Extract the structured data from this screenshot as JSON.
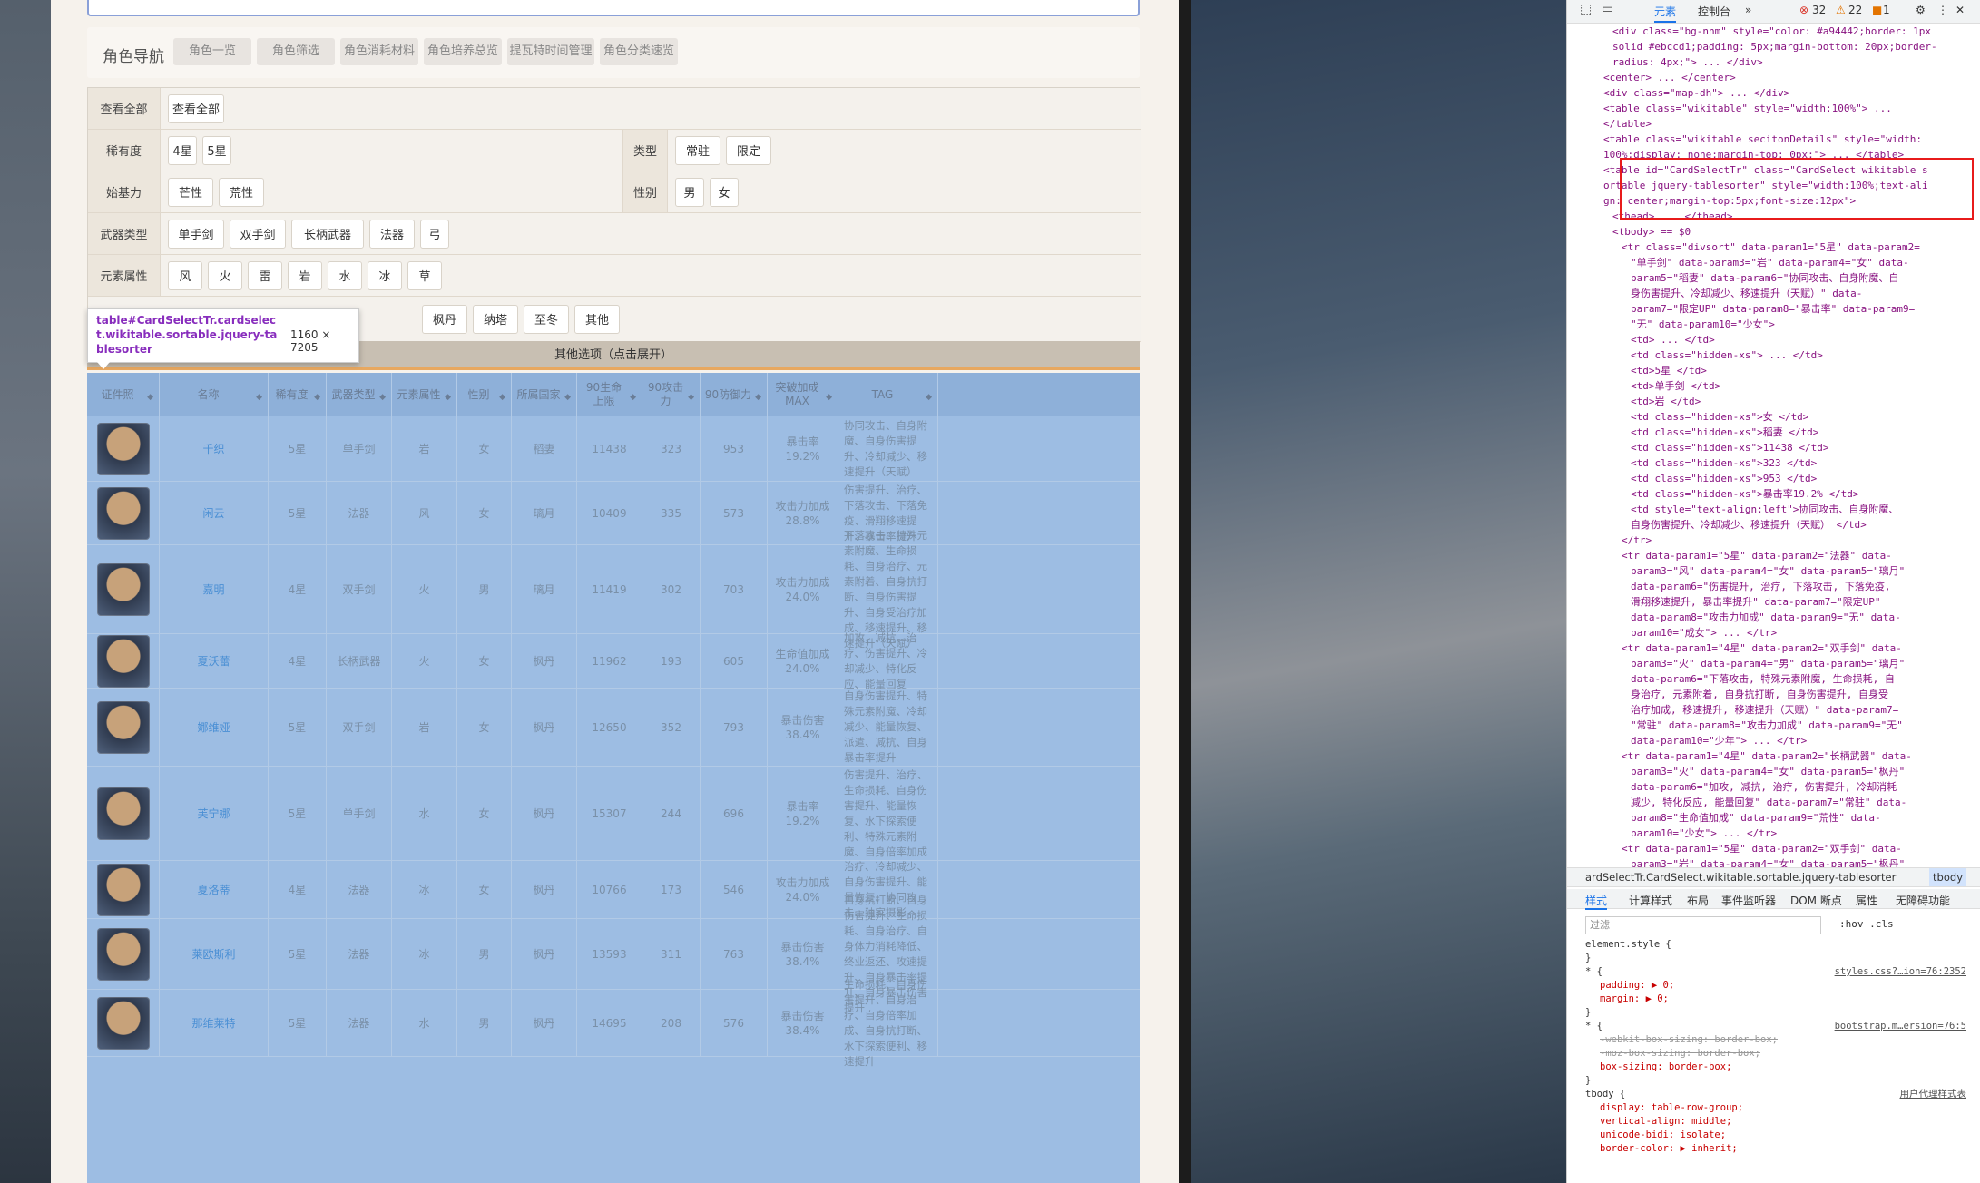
{
  "nav": {
    "title": "角色导航",
    "items": [
      "角色一览",
      "角色筛选",
      "角色消耗材料",
      "角色培养总览",
      "提瓦特时间管理",
      "角色分类速览"
    ]
  },
  "filters": {
    "view_all": {
      "label": "查看全部",
      "btn": "查看全部"
    },
    "rarity": {
      "label": "稀有度",
      "options": [
        "4星",
        "5星"
      ]
    },
    "type": {
      "label": "类型",
      "options": [
        "常驻",
        "限定"
      ]
    },
    "breakthrough": {
      "label": "始基力",
      "options": [
        "芒性",
        "荒性"
      ]
    },
    "gender": {
      "label": "性别",
      "options": [
        "男",
        "女"
      ]
    },
    "weapon": {
      "label": "武器类型",
      "options": [
        "单手剑",
        "双手剑",
        "长柄武器",
        "法器",
        "弓"
      ]
    },
    "element": {
      "label": "元素属性",
      "options": [
        "风",
        "火",
        "雷",
        "岩",
        "水",
        "冰",
        "草"
      ]
    },
    "region": {
      "options": [
        "枫丹",
        "纳塔",
        "至冬",
        "其他"
      ]
    }
  },
  "tooltip": {
    "selector": "table#CardSelectTr.cardselect.wikitable.sortable.jquery-tablesorter",
    "size": "1160 × 7205"
  },
  "other_options": "其他选项（点击展开）",
  "table": {
    "headers": [
      "证件照",
      "名称",
      "稀有度",
      "武器类型",
      "元素属性",
      "性别",
      "所属国家",
      "90生命上限",
      "90攻击力",
      "90防御力",
      "突破加成MAX",
      "TAG"
    ],
    "rows": [
      [
        "千织",
        "5星",
        "单手剑",
        "岩",
        "女",
        "稻妻",
        "11438",
        "323",
        "953",
        "暴击率19.2%",
        "协同攻击、自身附魔、自身伤害提升、冷却减少、移速提升（天赋）"
      ],
      [
        "闲云",
        "5星",
        "法器",
        "风",
        "女",
        "璃月",
        "10409",
        "335",
        "573",
        "攻击力加成28.8%",
        "伤害提升、治疗、下落攻击、下落免疫、滑翔移速提升、暴击率提升"
      ],
      [
        "嘉明",
        "4星",
        "双手剑",
        "火",
        "男",
        "璃月",
        "11419",
        "302",
        "703",
        "攻击力加成24.0%",
        "下落攻击、特殊元素附魔、生命损耗、自身治疗、元素附着、自身抗打断、自身伤害提升、自身受治疗加成、移速提升、移速提升（天赋）"
      ],
      [
        "夏沃蕾",
        "4星",
        "长柄武器",
        "火",
        "女",
        "枫丹",
        "11962",
        "193",
        "605",
        "生命值加成24.0%",
        "加攻、减抗、治疗、伤害提升、冷却减少、特化反应、能量回复"
      ],
      [
        "娜维娅",
        "5星",
        "双手剑",
        "岩",
        "女",
        "枫丹",
        "12650",
        "352",
        "793",
        "暴击伤害38.4%",
        "自身伤害提升、特殊元素附魔、冷却减少、能量恢复、派遣、减抗、自身暴击率提升"
      ],
      [
        "芙宁娜",
        "5星",
        "单手剑",
        "水",
        "女",
        "枫丹",
        "15307",
        "244",
        "696",
        "暴击率19.2%",
        "伤害提升、治疗、生命损耗、自身伤害提升、能量恢复、水下探索便利、特殊元素附魔、自身倍率加成"
      ],
      [
        "夏洛蒂",
        "4星",
        "法器",
        "冰",
        "女",
        "枫丹",
        "10766",
        "173",
        "546",
        "攻击力加成24.0%",
        "治疗、冷却减少、自身伤害提升、能量恢复、协同攻击、独家摄影"
      ],
      [
        "莱欧斯利",
        "5星",
        "法器",
        "冰",
        "男",
        "枫丹",
        "13593",
        "311",
        "763",
        "暴击伤害38.4%",
        "自身抗打断、自身伤害提升、生命损耗、自身治疗、自身体力消耗降低、终业返还、攻速提升、自身暴击率提升、自身暴击伤害提升"
      ],
      [
        "那维莱特",
        "5星",
        "法器",
        "水",
        "男",
        "枫丹",
        "14695",
        "208",
        "576",
        "暴击伤害38.4%",
        "生命损耗、自身伤害提升、自身治疗、自身倍率加成、自身抗打断、水下探索便利、移速提升"
      ]
    ]
  },
  "devtools": {
    "tabs": [
      "元素",
      "控制台"
    ],
    "errors": "32",
    "warnings": "22",
    "info": "1",
    "dom_lines": [
      "<div class=\"bg-nnm\" style=\"color: #a94442;border: 1px",
      "solid #ebccd1;padding: 5px;margin-bottom: 20px;border-",
      "radius: 4px;\"> ... </div>",
      "<center> ... </center>",
      "<div class=\"map-dh\"> ... </div>",
      "<table class=\"wikitable\" style=\"width:100%\"> ...",
      "</table>",
      "<table class=\"wikitable secitonDetails\" style=\"width:",
      "100%;display: none;margin-top: 0px;\"> ... </table>",
      "<table id=\"CardSelectTr\" class=\"CardSelect wikitable s",
      "ortable jquery-tablesorter\" style=\"width:100%;text-ali",
      "gn: center;margin-top:5px;font-size:12px\">",
      "<thead> ... </thead>",
      "<tbody> == $0",
      "<tr class=\"divsort\" data-param1=\"5星\" data-param2=",
      "\"单手剑\" data-param3=\"岩\" data-param4=\"女\" data-",
      "param5=\"稻妻\" data-param6=\"协同攻击、自身附魔、自",
      "身伤害提升、冷却减少、移速提升（天赋）\" data-",
      "param7=\"限定UP\" data-param8=\"暴击率\" data-param9=",
      "\"无\" data-param10=\"少女\">",
      "<td> ... </td>",
      "<td class=\"hidden-xs\"> ... </td>",
      "<td>5星 </td>",
      "<td>单手剑 </td>",
      "<td>岩 </td>",
      "<td class=\"hidden-xs\">女 </td>",
      "<td class=\"hidden-xs\">稻妻 </td>",
      "<td class=\"hidden-xs\">11438 </td>",
      "<td class=\"hidden-xs\">323 </td>",
      "<td class=\"hidden-xs\">953 </td>",
      "<td class=\"hidden-xs\">暴击率19.2% </td>",
      "<td style=\"text-align:left\">协同攻击、自身附魔、",
      "自身伤害提升、冷却减少、移速提升（天赋） </td>",
      "</tr>",
      "<tr data-param1=\"5星\" data-param2=\"法器\" data-",
      "param3=\"风\" data-param4=\"女\" data-param5=\"璃月\"",
      "data-param6=\"伤害提升, 治疗, 下落攻击, 下落免疫,",
      "滑翔移速提升, 暴击率提升\" data-param7=\"限定UP\"",
      "data-param8=\"攻击力加成\" data-param9=\"无\" data-",
      "param10=\"成女\"> ... </tr>",
      "<tr data-param1=\"4星\" data-param2=\"双手剑\" data-",
      "param3=\"火\" data-param4=\"男\" data-param5=\"璃月\"",
      "data-param6=\"下落攻击, 特殊元素附魔, 生命损耗, 自",
      "身治疗, 元素附着, 自身抗打断, 自身伤害提升, 自身受",
      "治疗加成, 移速提升, 移速提升（天赋）\" data-param7=",
      "\"常驻\" data-param8=\"攻击力加成\" data-param9=\"无\"",
      "data-param10=\"少年\"> ... </tr>",
      "<tr data-param1=\"4星\" data-param2=\"长柄武器\" data-",
      "param3=\"火\" data-param4=\"女\" data-param5=\"枫丹\"",
      "data-param6=\"加攻, 减抗, 治疗, 伤害提升, 冷却消耗",
      "减少, 特化反应, 能量回复\" data-param7=\"常驻\" data-",
      "param8=\"生命值加成\" data-param9=\"荒性\" data-",
      "param10=\"少女\"> ... </tr>",
      "<tr data-param1=\"5星\" data-param2=\"双手剑\" data-",
      "param3=\"岩\" data-param4=\"女\" data-param5=\"枫丹\""
    ],
    "breadcrumb": "ardSelectTr.CardSelect.wikitable.sortable.jquery-tablesorter",
    "breadcrumb_tail": "tbody",
    "style_tabs": [
      "样式",
      "计算样式",
      "布局",
      "事件监听器",
      "DOM 断点",
      "属性",
      "无障碍功能"
    ],
    "filter_placeholder": "过滤",
    "filter_tools": ":hov .cls",
    "styles": [
      "element.style {",
      "}",
      "* {",
      "padding: ▶ 0;",
      "margin: ▶ 0;",
      "}",
      "* {",
      "-webkit-box-sizing: border-box;",
      "-moz-box-sizing: border-box;",
      "box-sizing: border-box;",
      "}",
      "tbody {",
      "display: table-row-group;",
      "vertical-align: middle;",
      "unicode-bidi: isolate;",
      "border-color: ▶ inherit;"
    ],
    "style_src1": "styles.css?…ion=76:2352",
    "style_src2": "bootstrap.m…ersion=76:5",
    "style_src3": "用户代理样式表"
  }
}
